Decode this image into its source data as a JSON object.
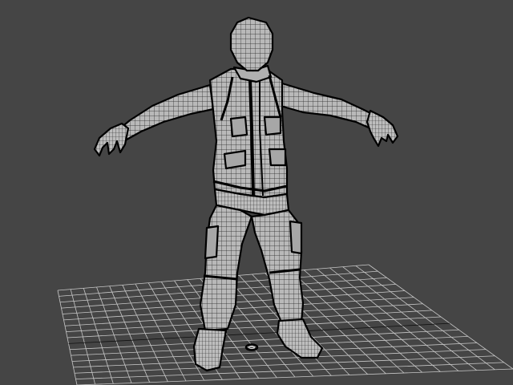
{
  "viewport": {
    "background_color": "#454545",
    "grid_color": "#c8c8c8",
    "model_fill_color": "#b9b9b9",
    "model_shade_color": "#9a9a9a",
    "wire_color": "#111111",
    "outline_color": "#000000",
    "scene_object": "character-wireframe-mesh",
    "pivot_marker": "pivot-gizmo-icon"
  }
}
